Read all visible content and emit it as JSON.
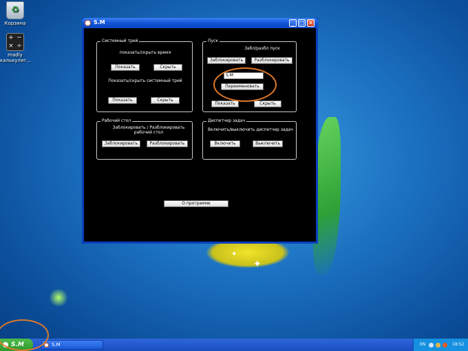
{
  "desktop": {
    "icons": [
      {
        "label": "Корзина",
        "icon": "recycle-bin-icon"
      },
      {
        "label": "madly калькулят...",
        "icon": "calculator-icon"
      }
    ]
  },
  "window": {
    "title": "S.M",
    "minimize_glyph": "_",
    "maximize_glyph": "□",
    "close_glyph": "✕",
    "tray_group": {
      "legend": "Системный трей",
      "time_label": "показать/скрыть время",
      "show_time_button": "Показать",
      "hide_time_button": "Скрыть",
      "tray_label": "Показать/скрыть системный трей",
      "show_tray_button": "Показать",
      "hide_tray_button": "Скрыть"
    },
    "start_group": {
      "legend": "Пуск",
      "lock_label": "Забл/разбл пуск",
      "lock_button": "Заблокировать",
      "unlock_button": "Разблокировать",
      "rename_input_value": "S.M",
      "rename_button": "Переименовать",
      "show_button": "Показать",
      "hide_button": "Скрыть"
    },
    "desktop_group": {
      "legend": "Рабочий стол",
      "label": "Заблокировать / Разблокировать рабочий стол",
      "lock_button": "Заблокировать",
      "unlock_button": "Разблокировать"
    },
    "taskmgr_group": {
      "legend": "Диспетчер задач",
      "label": "Включить/выключить диспетчер задач",
      "enable_button": "Включить",
      "disable_button": "Выключить"
    },
    "about_button": "О программе"
  },
  "taskbar": {
    "start_label": "S.M",
    "task_item": "S.M",
    "language": "EN",
    "clock": "18:52"
  },
  "colors": {
    "highlight_ring": "#e07a2a",
    "window_frame": "#0a3fc0"
  }
}
